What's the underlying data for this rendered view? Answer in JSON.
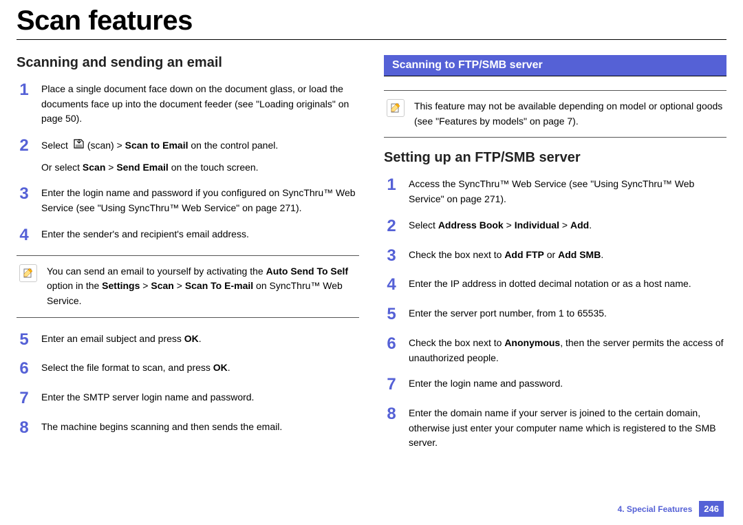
{
  "page_title": "Scan features",
  "left": {
    "heading": "Scanning and sending an email",
    "steps_a": [
      {
        "n": "1",
        "html": "Place a single document face down on the document glass, or load the documents face up into the document feeder (see \"Loading originals\" on page 50)."
      },
      {
        "n": "2",
        "html": "Select {SCANICON}(scan) > <b>Scan to Email</b> on the control panel.<span class=\"sub\">Or select <b>Scan</b> > <b>Send Email</b> on the touch screen.</span>"
      },
      {
        "n": "3",
        "html": "Enter the login name and password if you configured on SyncThru™ Web Service (see \"Using SyncThru™ Web Service\" on page 271)."
      },
      {
        "n": "4",
        "html": "Enter the sender's and recipient's email address."
      }
    ],
    "note": "You can send an email to yourself by activating the <b>Auto Send To Self</b> option in the <b>Settings</b> > <b>Scan</b> > <b>Scan To E-mail</b> on SyncThru™ Web Service.",
    "steps_b": [
      {
        "n": "5",
        "html": "Enter an email subject and press <b>OK</b>."
      },
      {
        "n": "6",
        "html": "Select the file format to scan, and press <b>OK</b>."
      },
      {
        "n": "7",
        "html": "Enter the SMTP server login name and password."
      },
      {
        "n": "8",
        "html": "The machine begins scanning and then sends the email."
      }
    ]
  },
  "right": {
    "banner": "Scanning to FTP/SMB server",
    "note": "This feature may not be available depending on model or optional goods (see \"Features by models\" on page 7).",
    "heading": "Setting up an FTP/SMB server",
    "steps": [
      {
        "n": "1",
        "html": "Access the SyncThru™ Web Service (see \"Using SyncThru™ Web Service\" on page 271)."
      },
      {
        "n": "2",
        "html": "Select <b>Address Book</b> > <b>Individual</b> > <b>Add</b>."
      },
      {
        "n": "3",
        "html": "Check the box next to <b>Add FTP</b> or <b>Add SMB</b>."
      },
      {
        "n": "4",
        "html": "Enter the IP address in dotted decimal notation or as a host name."
      },
      {
        "n": "5",
        "html": "Enter the server port number, from 1 to 65535."
      },
      {
        "n": "6",
        "html": "Check the box next to <b>Anonymous</b>, then the server permits the access of unauthorized people."
      },
      {
        "n": "7",
        "html": "Enter the login name and password."
      },
      {
        "n": "8",
        "html": "Enter the domain name if your server is joined to the certain domain, otherwise just enter your computer name which is registered to the SMB server."
      }
    ]
  },
  "footer": {
    "chapter": "4.  Special Features",
    "page": "246"
  }
}
